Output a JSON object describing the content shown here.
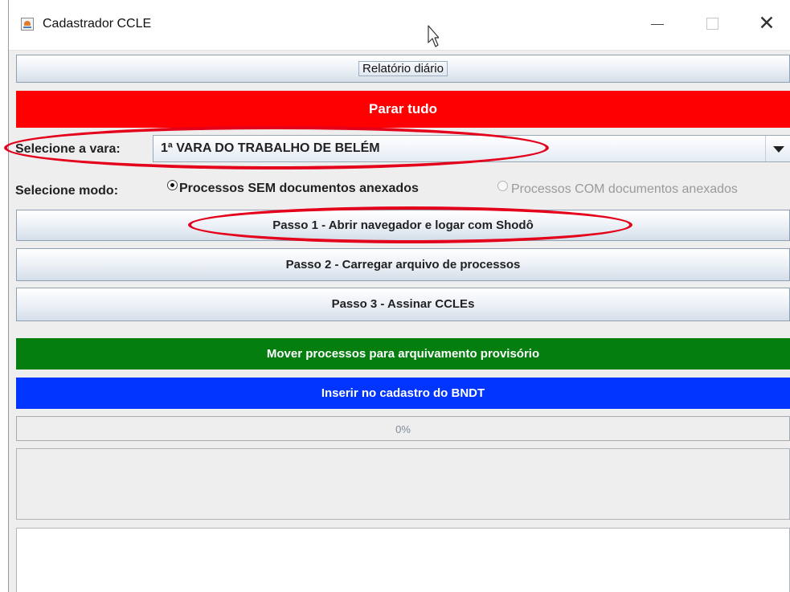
{
  "window": {
    "title": "Cadastrador CCLE",
    "icon": "java-cup-icon"
  },
  "buttons": {
    "daily_report": "Relatório diário",
    "stop_all": "Parar tudo",
    "step1": "Passo 1 - Abrir navegador e logar com Shodô",
    "step2": "Passo 2 - Carregar arquivo de processos",
    "step3": "Passo 3 - Assinar CCLEs",
    "move_processes": "Mover processos para arquivamento provisório",
    "insert_bndt": "Inserir no cadastro do BNDT"
  },
  "court_select": {
    "label": "Selecione a vara:",
    "value": "1ª VARA DO TRABALHO DE BELÉM"
  },
  "mode": {
    "label": "Selecione modo:",
    "options": [
      {
        "label": "Processos SEM documentos anexados",
        "selected": true,
        "enabled": true
      },
      {
        "label": "Processos COM documentos anexados",
        "selected": false,
        "enabled": false
      }
    ]
  },
  "progress": {
    "value": 0,
    "text": "0%"
  },
  "colors": {
    "stop_button": "#ff0000",
    "move_button": "#047e0f",
    "bndt_button": "#0034ff",
    "annotation": "#e4001b"
  }
}
